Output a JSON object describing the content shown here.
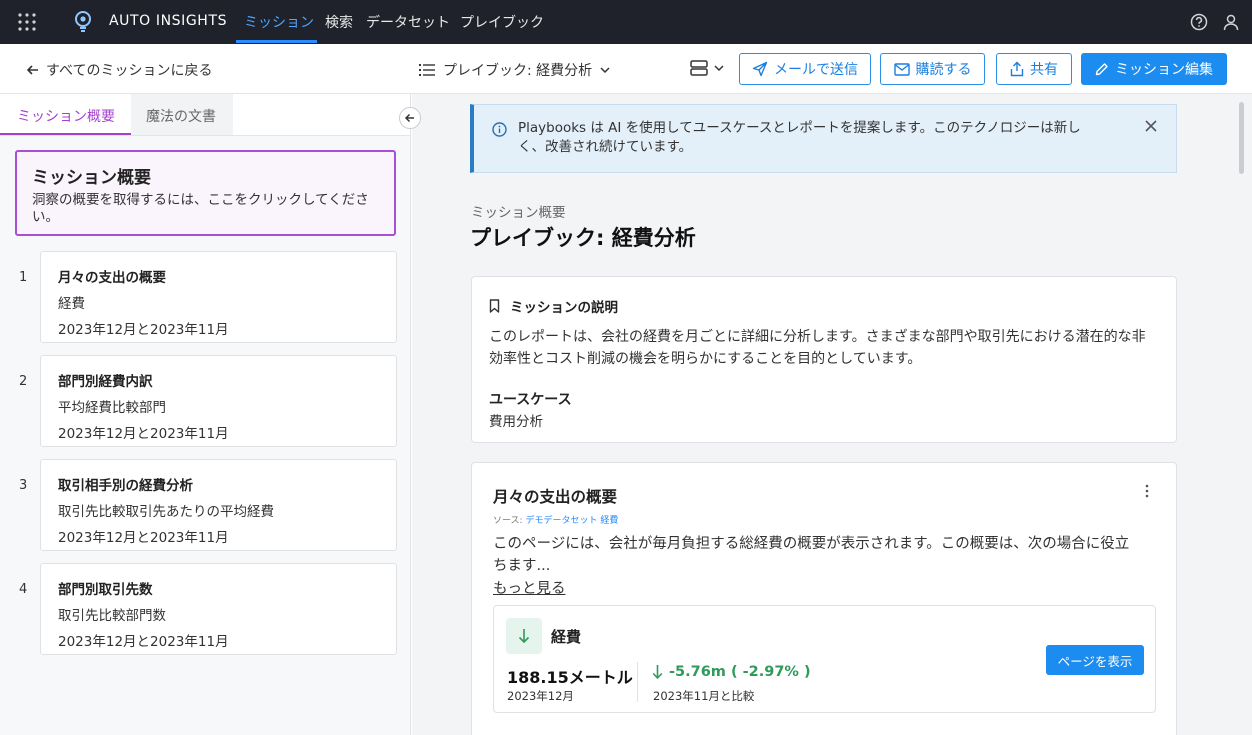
{
  "nav": {
    "brand": "AUTO INSIGHTS",
    "items": [
      {
        "label": "ミッション",
        "active": true
      },
      {
        "label": "検索"
      },
      {
        "label": "データセット"
      },
      {
        "label": "プレイブック"
      }
    ]
  },
  "subbar": {
    "back": "すべてのミッションに戻る",
    "playbook": "プレイブック: 経費分析",
    "buttons": {
      "email": "メールで送信",
      "subscribe": "購読する",
      "share": "共有",
      "edit": "ミッション編集"
    }
  },
  "left": {
    "tabs": [
      "ミッション概要",
      "魔法の文書"
    ],
    "overview": {
      "title": "ミッション概要",
      "desc": "洞察の概要を取得するには、ここをクリックしてください。"
    },
    "steps": [
      {
        "num": "1",
        "title": "月々の支出の概要",
        "line1": "経費",
        "line2": "2023年12月と2023年11月"
      },
      {
        "num": "2",
        "title": "部門別経費内訳",
        "line1": "平均経費比較部門",
        "line2": "2023年12月と2023年11月"
      },
      {
        "num": "3",
        "title": "取引相手別の経費分析",
        "line1": "取引先比較取引先あたりの平均経費",
        "line2": "2023年12月と2023年11月"
      },
      {
        "num": "4",
        "title": "部門別取引先数",
        "line1": "取引先比較部門数",
        "line2": "2023年12月と2023年11月"
      }
    ]
  },
  "main": {
    "banner": "Playbooks は AI を使用してユースケースとレポートを提案します。このテクノロジーは新しく、改善され続けています。",
    "crumb": "ミッション概要",
    "title": "プレイブック: 経費分析",
    "desc_card": {
      "header": "ミッションの説明",
      "body": "このレポートは、会社の経費を月ごとに詳細に分析します。さまざまな部門や取引先における潜在的な非効率性とコスト削減の機会を明らかにすることを目的としています。",
      "usecase_label": "ユースケース",
      "usecase_value": "費用分析"
    },
    "section": {
      "title": "月々の支出の概要",
      "source_label": "ソース: ",
      "source_link": "デモデータセット 経費",
      "body": "このページには、会社が毎月負担する総経費の概要が表示されます。この概要は、次の場合に役立ちます...",
      "more": "もっと見る",
      "metric": {
        "name": "経費",
        "value": "188.15メートル",
        "period": "2023年12月",
        "change": "-5.76m ( -2.97% )",
        "compare": "2023年11月と比較",
        "button": "ページを表示"
      }
    }
  }
}
